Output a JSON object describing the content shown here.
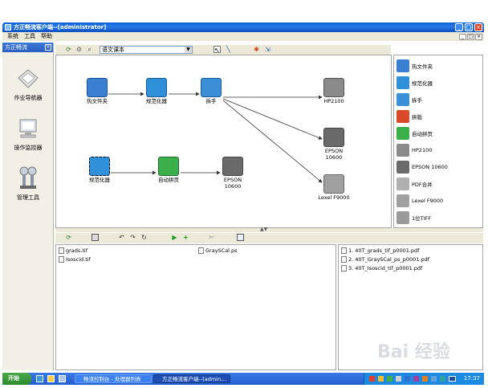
{
  "window": {
    "title": "方正畅流客户端--[administrator]"
  },
  "menu": [
    "系统",
    "工具",
    "帮助"
  ],
  "left_panel": {
    "title": "方正畅流",
    "items": [
      {
        "label": "作业导航器",
        "icon": "navigator-icon"
      },
      {
        "label": "操作监控器",
        "icon": "monitor-icon"
      },
      {
        "label": "管理工具",
        "icon": "tools-icon"
      }
    ]
  },
  "toolbar": {
    "process_combo": "语文课本"
  },
  "flow": {
    "nodes": [
      {
        "id": "hotfolder",
        "label": "热文件夹",
        "color": "#3b7fd0"
      },
      {
        "id": "normalizer1",
        "label": "规范化器",
        "color": "#2f8fd8"
      },
      {
        "id": "splitter",
        "label": "拆手",
        "color": "#3a8fd6"
      },
      {
        "id": "hp2100",
        "label": "HP2100",
        "color": "#8a8a8a"
      },
      {
        "id": "epson1",
        "label": "EPSON 10600",
        "color": "#6a6a6a"
      },
      {
        "id": "lexel",
        "label": "Lexel F9000",
        "color": "#a0a0a0"
      },
      {
        "id": "normalizer2",
        "label": "规范化器",
        "color": "#2f8fd8"
      },
      {
        "id": "imposer",
        "label": "自动拼页",
        "color": "#3bb04a"
      },
      {
        "id": "epson2",
        "label": "EPSON 10600",
        "color": "#6a6a6a"
      }
    ]
  },
  "palette": [
    {
      "label": "热文件夹",
      "icon": "hotfolder-icon",
      "color": "#3b7fd0"
    },
    {
      "label": "规范化器",
      "icon": "normalizer-icon",
      "color": "#2f8fd8"
    },
    {
      "label": "拆手",
      "icon": "splitter-icon",
      "color": "#3a8fd6"
    },
    {
      "label": "拼版",
      "icon": "imposition-icon",
      "color": "#d84a2a"
    },
    {
      "label": "自动拼页",
      "icon": "auto-impose-icon",
      "color": "#3bb04a"
    },
    {
      "label": "HP2100",
      "icon": "printer-icon",
      "color": "#8a8a8a"
    },
    {
      "label": "EPSON 10600",
      "icon": "plotter-icon",
      "color": "#6a6a6a"
    },
    {
      "label": "PDF合并",
      "icon": "pdf-merge-icon",
      "color": "#b0b0b0"
    },
    {
      "label": "Lexel F9000",
      "icon": "lexel-icon",
      "color": "#a0a0a0"
    },
    {
      "label": "1位TIFF",
      "icon": "tiff-icon",
      "color": "#9a9a9a"
    }
  ],
  "input_files": [
    "grads.tif",
    "GraySCal.ps",
    "Isoscid.tif"
  ],
  "output_files": [
    "1. 40T_grads_tif_p0001.pdf",
    "2. 40T_GraySCal_ps_p0001.pdf",
    "3. 40T_Isoscid_tif_p0001.pdf"
  ],
  "taskbar": {
    "start": "开始",
    "tasks": [
      "畅流控制台 - 处理器列表",
      "方正畅流客户端--[admin..."
    ],
    "clock": "17:37"
  },
  "watermark": "Bai 经验"
}
